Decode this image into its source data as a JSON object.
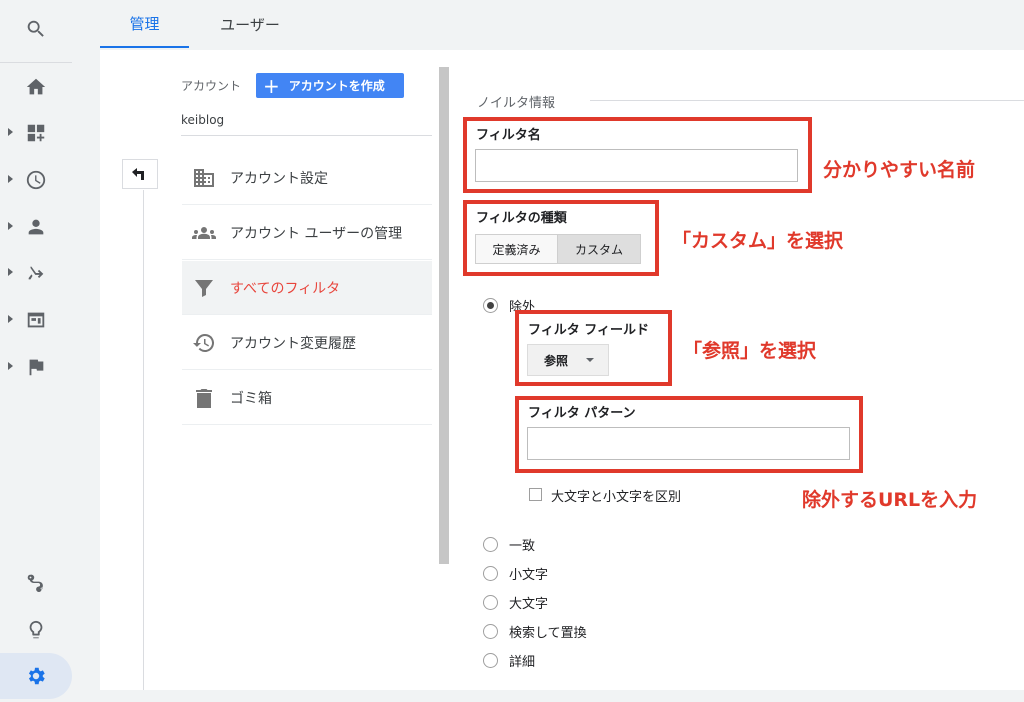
{
  "tabs": {
    "admin": "管理",
    "user": "ユーザー"
  },
  "account": {
    "label": "アカウント",
    "create_button": "アカウントを作成",
    "name": "keiblog"
  },
  "menu": [
    {
      "label": "アカウント設定",
      "icon": "building-icon"
    },
    {
      "label": "アカウント ユーザーの管理",
      "icon": "people-icon"
    },
    {
      "label": "すべてのフィルタ",
      "icon": "filter-icon",
      "active": true
    },
    {
      "label": "アカウント変更履歴",
      "icon": "history-icon"
    },
    {
      "label": "ゴミ箱",
      "icon": "trash-icon"
    }
  ],
  "form": {
    "section_title": "ノイルタ情報",
    "filter_name_label": "フィルタ名",
    "filter_name_value": "",
    "filter_type_label": "フィルタの種類",
    "type_predefined": "定義済み",
    "type_custom": "カスタム",
    "exclude_label": "除外",
    "filter_field_label": "フィルタ フィールド",
    "filter_field_value": "参照",
    "filter_pattern_label": "フィルタ パターン",
    "filter_pattern_value": "",
    "case_sensitive_label": "大文字と小文字を区別",
    "options": [
      "一致",
      "小文字",
      "大文字",
      "検索して置換",
      "詳細"
    ]
  },
  "annotations": {
    "name": "分かりやすい名前",
    "custom": "「カスタム」を選択",
    "reference": "「参照」を選択",
    "url": "除外するURLを入力"
  },
  "colors": {
    "accent": "#1a73e8",
    "button": "#4285f4",
    "annotation": "#e0392b",
    "active_menu": "#e8453c"
  }
}
